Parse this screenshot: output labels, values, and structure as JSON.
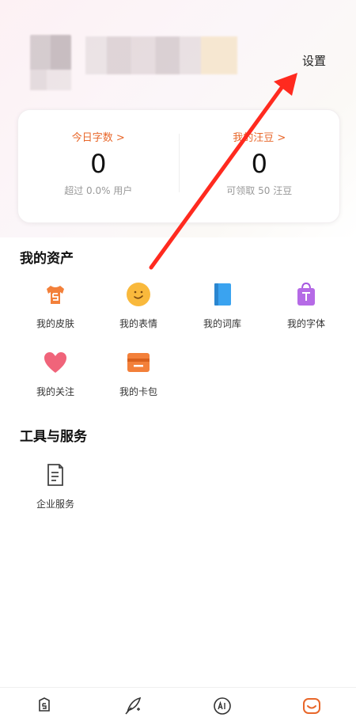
{
  "header": {
    "settings_label": "设置"
  },
  "stats": {
    "left": {
      "title": "今日字数 >",
      "value": "0",
      "sub": "超过 0.0% 用户"
    },
    "right": {
      "title": "我的汪豆 >",
      "value": "0",
      "sub": "可领取 50 汪豆"
    }
  },
  "assets": {
    "title": "我的资产",
    "items": [
      {
        "label": "我的皮肤",
        "icon": "shirt-icon"
      },
      {
        "label": "我的表情",
        "icon": "smiley-icon"
      },
      {
        "label": "我的词库",
        "icon": "book-icon"
      },
      {
        "label": "我的字体",
        "icon": "bag-icon"
      },
      {
        "label": "我的关注",
        "icon": "heart-icon"
      },
      {
        "label": "我的卡包",
        "icon": "card-icon"
      }
    ]
  },
  "tools": {
    "title": "工具与服务",
    "items": [
      {
        "label": "企业服务",
        "icon": "document-icon"
      }
    ]
  },
  "nav": {
    "items": [
      {
        "label": "",
        "icon": "shop-icon"
      },
      {
        "label": "",
        "icon": "quill-icon"
      },
      {
        "label": "",
        "icon": "ai-icon"
      },
      {
        "label": "",
        "icon": "profile-icon",
        "active": true
      }
    ]
  },
  "colors": {
    "accent": "#e8672a",
    "annotation_arrow": "#ff2a1f"
  }
}
